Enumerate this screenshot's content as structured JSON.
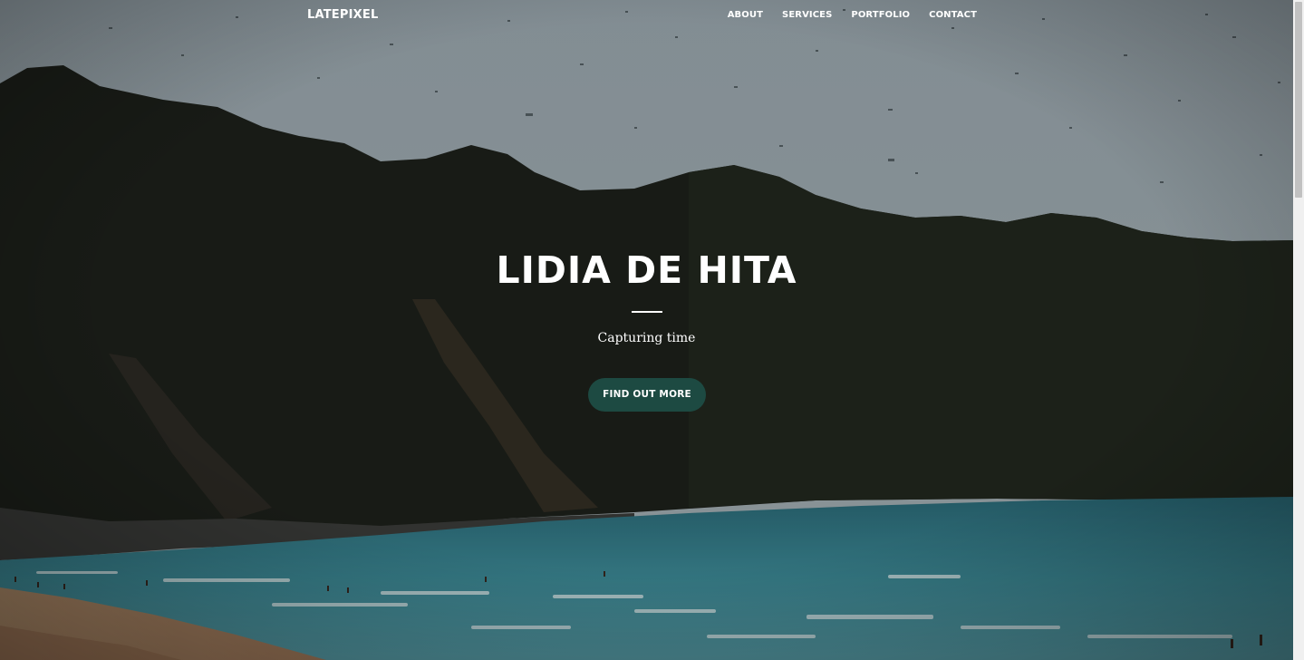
{
  "navbar": {
    "brand": "LATEPIXEL",
    "links": [
      "ABOUT",
      "SERVICES",
      "PORTFOLIO",
      "CONTACT"
    ]
  },
  "hero": {
    "title": "LIDIA DE HITA",
    "subtitle": "Capturing time",
    "button_label": "FIND OUT MORE",
    "button_color": "#1d4a42",
    "background": "photo of dark wooded cliffs above a turquoise sea and sandy beach under an overcast sky"
  },
  "colors": {
    "sky": "#a3afb4",
    "cliff": "#1f221c",
    "sea": "#3f8f9c",
    "sand": "#b08a6a"
  }
}
